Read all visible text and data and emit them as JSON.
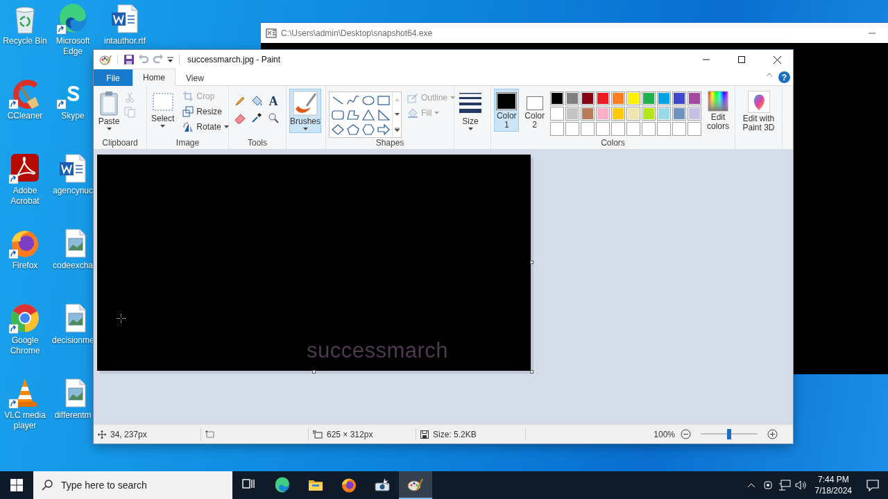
{
  "desktop": {
    "icons": [
      {
        "label": "Recycle Bin",
        "kind": "recycle-bin",
        "shortcut": false
      },
      {
        "label": "CCleaner",
        "kind": "ccleaner",
        "shortcut": true
      },
      {
        "label": "Adobe Acrobat",
        "kind": "acrobat",
        "shortcut": true
      },
      {
        "label": "Firefox",
        "kind": "firefox",
        "shortcut": true
      },
      {
        "label": "Google Chrome",
        "kind": "chrome",
        "shortcut": true
      },
      {
        "label": "VLC media player",
        "kind": "vlc",
        "shortcut": true
      },
      {
        "label": "Microsoft Edge",
        "kind": "edge",
        "shortcut": true
      },
      {
        "label": "Skype",
        "kind": "skype",
        "shortcut": true
      },
      {
        "label": "agencynuc",
        "kind": "word",
        "shortcut": false
      },
      {
        "label": "codeexcha",
        "kind": "image",
        "shortcut": false
      },
      {
        "label": "decisionme",
        "kind": "image",
        "shortcut": false
      },
      {
        "label": "differentm",
        "kind": "image",
        "shortcut": false
      },
      {
        "label": "intauthor.rtf",
        "kind": "word",
        "shortcut": false
      }
    ]
  },
  "console_window": {
    "title": "C:\\Users\\admin\\Desktop\\snapshot64.exe"
  },
  "paint": {
    "title": "successmarch.jpg - Paint",
    "tabs": [
      {
        "label": "File",
        "kind": "file",
        "selected": false
      },
      {
        "label": "Home",
        "kind": "tab",
        "selected": true
      },
      {
        "label": "View",
        "kind": "tab",
        "selected": false
      }
    ],
    "help": "?",
    "clipboard": {
      "label": "Clipboard",
      "paste": "Paste",
      "cut": {
        "disabled": true
      },
      "copy": {
        "disabled": true
      }
    },
    "image": {
      "label": "Image",
      "select": "Select",
      "crop": {
        "label": "Crop",
        "disabled": true
      },
      "resize": {
        "label": "Resize",
        "disabled": false
      },
      "rotate": {
        "label": "Rotate",
        "disabled": false
      }
    },
    "tools": {
      "label": "Tools",
      "text_tool": "A"
    },
    "brushes": {
      "label": "Brushes",
      "selected": true
    },
    "shapes": {
      "label": "Shapes",
      "outline": {
        "label": "Outline",
        "disabled": true
      },
      "fill": {
        "label": "Fill",
        "disabled": true
      }
    },
    "size": {
      "label": "Size"
    },
    "colors": {
      "label": "Colors",
      "color1": {
        "label": "Color 1",
        "color": "#000000",
        "selected": true
      },
      "color2": {
        "label": "Color 2",
        "color": "#ffffff",
        "selected": false
      },
      "palette": [
        {
          "color": "#000000"
        },
        {
          "color": "#7f7f7f"
        },
        {
          "color": "#880015"
        },
        {
          "color": "#ed1c24"
        },
        {
          "color": "#ff7f27"
        },
        {
          "color": "#fff200"
        },
        {
          "color": "#22b14c"
        },
        {
          "color": "#00a2e8"
        },
        {
          "color": "#3f48cc"
        },
        {
          "color": "#a349a4"
        },
        {
          "color": "#ffffff"
        },
        {
          "color": "#c3c3c3"
        },
        {
          "color": "#b97a57"
        },
        {
          "color": "#ffaec9"
        },
        {
          "color": "#ffc90e"
        },
        {
          "color": "#efe4b0"
        },
        {
          "color": "#b5e61d"
        },
        {
          "color": "#99d9ea"
        },
        {
          "color": "#7092be"
        },
        {
          "color": "#c8bfe7"
        }
      ],
      "edit": "Edit colors"
    },
    "paint3d": {
      "label": "Edit with Paint 3D"
    },
    "canvas": {
      "text": "successmarch"
    },
    "status": {
      "position": "34, 237px",
      "image_size": "625 × 312px",
      "file_size": "Size: 5.2KB",
      "zoom": "100%",
      "zoom_slider": {
        "level": 0.5
      }
    }
  },
  "taskbar": {
    "search": {
      "placeholder": "Type here to search"
    },
    "apps": [
      {
        "kind": "task-view",
        "selected": false
      },
      {
        "kind": "edge",
        "selected": false
      },
      {
        "kind": "explorer",
        "selected": false
      },
      {
        "kind": "firefox",
        "selected": false
      },
      {
        "kind": "snapshot",
        "selected": false
      },
      {
        "kind": "paint",
        "selected": true
      }
    ],
    "clock": {
      "time": "7:44 PM",
      "date": "7/18/2024"
    }
  }
}
